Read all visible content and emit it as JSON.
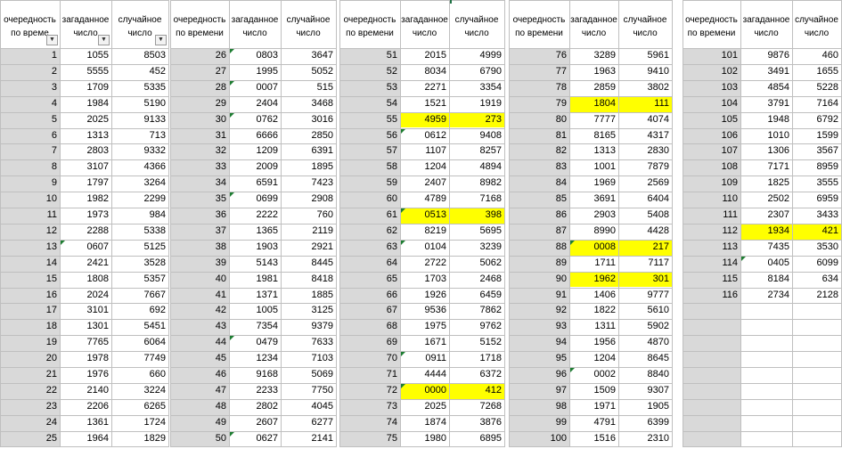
{
  "headers": {
    "col1_line1": "очередность",
    "col1_line2_first": "по време",
    "col1_line2": "по времени",
    "col2_line1": "загаданное",
    "col2_line2": "число",
    "col3_line1": "случайное",
    "col3_line2": "число"
  },
  "icons": {
    "filter": "filter-dropdown-icon",
    "error_indicator": "green-triangle-icon"
  },
  "colors": {
    "highlight": "#ffff00",
    "order_column": "#d9d9d9",
    "error_indicator": "#1e7d32"
  },
  "blocks": [
    {
      "rows": [
        [
          "1",
          "1055",
          "8503"
        ],
        [
          "2",
          "5555",
          "452"
        ],
        [
          "3",
          "1709",
          "5335"
        ],
        [
          "4",
          "1984",
          "5190"
        ],
        [
          "5",
          "2025",
          "9133"
        ],
        [
          "6",
          "1313",
          "713"
        ],
        [
          "7",
          "2803",
          "9332"
        ],
        [
          "8",
          "3107",
          "4366"
        ],
        [
          "9",
          "1797",
          "3264"
        ],
        [
          "10",
          "1982",
          "2299"
        ],
        [
          "11",
          "1973",
          "984"
        ],
        [
          "12",
          "2288",
          "5338"
        ],
        [
          "13",
          "0607",
          "5125"
        ],
        [
          "14",
          "2421",
          "3528"
        ],
        [
          "15",
          "1808",
          "5357"
        ],
        [
          "16",
          "2024",
          "7667"
        ],
        [
          "17",
          "3101",
          "692"
        ],
        [
          "18",
          "1301",
          "5451"
        ],
        [
          "19",
          "7765",
          "6064"
        ],
        [
          "20",
          "1978",
          "7749"
        ],
        [
          "21",
          "1976",
          "660"
        ],
        [
          "22",
          "2140",
          "3224"
        ],
        [
          "23",
          "2206",
          "6265"
        ],
        [
          "24",
          "1361",
          "1724"
        ],
        [
          "25",
          "1964",
          "1829"
        ]
      ],
      "highlighted_rows": [],
      "error_rows": [
        13
      ]
    },
    {
      "rows": [
        [
          "26",
          "0803",
          "3647"
        ],
        [
          "27",
          "1995",
          "5052"
        ],
        [
          "28",
          "0007",
          "515"
        ],
        [
          "29",
          "2404",
          "3468"
        ],
        [
          "30",
          "0762",
          "3016"
        ],
        [
          "31",
          "6666",
          "2850"
        ],
        [
          "32",
          "1209",
          "6391"
        ],
        [
          "33",
          "2009",
          "1895"
        ],
        [
          "34",
          "6591",
          "7423"
        ],
        [
          "35",
          "0699",
          "2908"
        ],
        [
          "36",
          "2222",
          "760"
        ],
        [
          "37",
          "1365",
          "2119"
        ],
        [
          "38",
          "1903",
          "2921"
        ],
        [
          "39",
          "5143",
          "8445"
        ],
        [
          "40",
          "1981",
          "8418"
        ],
        [
          "41",
          "1371",
          "1885"
        ],
        [
          "42",
          "1005",
          "3125"
        ],
        [
          "43",
          "7354",
          "9379"
        ],
        [
          "44",
          "0479",
          "7633"
        ],
        [
          "45",
          "1234",
          "7103"
        ],
        [
          "46",
          "9168",
          "5069"
        ],
        [
          "47",
          "2233",
          "7750"
        ],
        [
          "48",
          "2802",
          "4045"
        ],
        [
          "49",
          "2607",
          "6277"
        ],
        [
          "50",
          "0627",
          "2141"
        ]
      ],
      "highlighted_rows": [],
      "error_rows": [
        26,
        28,
        30,
        35,
        44,
        50
      ]
    },
    {
      "rows": [
        [
          "51",
          "2015",
          "4999"
        ],
        [
          "52",
          "8034",
          "6790"
        ],
        [
          "53",
          "2271",
          "3354"
        ],
        [
          "54",
          "1521",
          "1919"
        ],
        [
          "55",
          "4959",
          "273"
        ],
        [
          "56",
          "0612",
          "9408"
        ],
        [
          "57",
          "1107",
          "8257"
        ],
        [
          "58",
          "1204",
          "4894"
        ],
        [
          "59",
          "2407",
          "8982"
        ],
        [
          "60",
          "4789",
          "7168"
        ],
        [
          "61",
          "0513",
          "398"
        ],
        [
          "62",
          "8219",
          "5695"
        ],
        [
          "63",
          "0104",
          "3239"
        ],
        [
          "64",
          "2722",
          "5062"
        ],
        [
          "65",
          "1703",
          "2468"
        ],
        [
          "66",
          "1926",
          "6459"
        ],
        [
          "67",
          "9536",
          "7862"
        ],
        [
          "68",
          "1975",
          "9762"
        ],
        [
          "69",
          "1671",
          "5152"
        ],
        [
          "70",
          "0911",
          "1718"
        ],
        [
          "71",
          "4444",
          "6372"
        ],
        [
          "72",
          "0000",
          "412"
        ],
        [
          "73",
          "2025",
          "7268"
        ],
        [
          "74",
          "1874",
          "3876"
        ],
        [
          "75",
          "1980",
          "6895"
        ]
      ],
      "highlighted_rows": [
        55,
        61,
        72
      ],
      "error_rows": [
        56,
        61,
        63,
        70,
        72
      ]
    },
    {
      "rows": [
        [
          "76",
          "3289",
          "5961"
        ],
        [
          "77",
          "1963",
          "9410"
        ],
        [
          "78",
          "2859",
          "3802"
        ],
        [
          "79",
          "1804",
          "111"
        ],
        [
          "80",
          "7777",
          "4074"
        ],
        [
          "81",
          "8165",
          "4317"
        ],
        [
          "82",
          "1313",
          "2830"
        ],
        [
          "83",
          "1001",
          "7879"
        ],
        [
          "84",
          "1969",
          "2569"
        ],
        [
          "85",
          "3691",
          "6404"
        ],
        [
          "86",
          "2903",
          "5408"
        ],
        [
          "87",
          "8990",
          "4428"
        ],
        [
          "88",
          "0008",
          "217"
        ],
        [
          "89",
          "1711",
          "7117"
        ],
        [
          "90",
          "1962",
          "301"
        ],
        [
          "91",
          "1406",
          "9777"
        ],
        [
          "92",
          "1822",
          "5610"
        ],
        [
          "93",
          "1311",
          "5902"
        ],
        [
          "94",
          "1956",
          "4870"
        ],
        [
          "95",
          "1204",
          "8645"
        ],
        [
          "96",
          "0002",
          "8840"
        ],
        [
          "97",
          "1509",
          "9307"
        ],
        [
          "98",
          "1971",
          "1905"
        ],
        [
          "99",
          "4791",
          "6399"
        ],
        [
          "100",
          "1516",
          "2310"
        ]
      ],
      "highlighted_rows": [
        79,
        88,
        90
      ],
      "error_rows": [
        88,
        96
      ]
    },
    {
      "rows": [
        [
          "101",
          "9876",
          "460"
        ],
        [
          "102",
          "3491",
          "1655"
        ],
        [
          "103",
          "4854",
          "5228"
        ],
        [
          "104",
          "3791",
          "7164"
        ],
        [
          "105",
          "1948",
          "6792"
        ],
        [
          "106",
          "1010",
          "1599"
        ],
        [
          "107",
          "1306",
          "3567"
        ],
        [
          "108",
          "7171",
          "8959"
        ],
        [
          "109",
          "1825",
          "3555"
        ],
        [
          "110",
          "2502",
          "6959"
        ],
        [
          "111",
          "2307",
          "3433"
        ],
        [
          "112",
          "1934",
          "421"
        ],
        [
          "113",
          "7435",
          "3530"
        ],
        [
          "114",
          "0405",
          "6099"
        ],
        [
          "115",
          "8184",
          "634"
        ],
        [
          "116",
          "2734",
          "2128"
        ]
      ],
      "highlighted_rows": [
        112
      ],
      "error_rows": [
        114
      ]
    }
  ]
}
